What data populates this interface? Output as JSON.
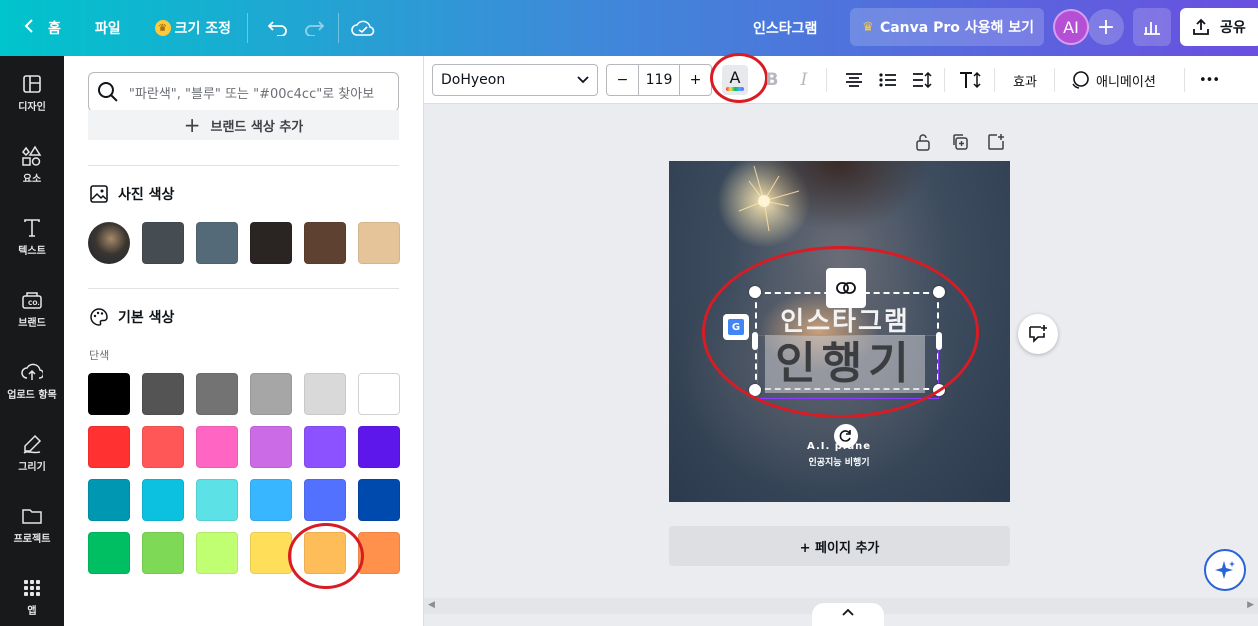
{
  "topbar": {
    "home_label": "홈",
    "file_label": "파일",
    "resize_label": "크기 조정",
    "doc_title": "인스타그램",
    "pro_label": "Canva Pro 사용해 보기",
    "avatar_initials": "AI",
    "share_label": "공유"
  },
  "rail": {
    "items": [
      {
        "label": "디자인",
        "icon": "layout-icon"
      },
      {
        "label": "요소",
        "icon": "shapes-icon"
      },
      {
        "label": "텍스트",
        "icon": "text-icon"
      },
      {
        "label": "브랜드",
        "icon": "brand-icon"
      },
      {
        "label": "업로드 항목",
        "icon": "upload-icon"
      },
      {
        "label": "그리기",
        "icon": "draw-icon"
      },
      {
        "label": "프로젝트",
        "icon": "folder-icon"
      },
      {
        "label": "앱",
        "icon": "apps-icon"
      }
    ]
  },
  "panel": {
    "search_placeholder": "\"파란색\", \"블루\" 또는 \"#00c4cc\"로 찾아보",
    "brand_add_label": "브랜드 색상 추가",
    "photo_colors_title": "사진 색상",
    "photo_colors": [
      "#454d52",
      "#546a78",
      "#2a2522",
      "#5f4131",
      "#e5c49a"
    ],
    "default_colors_title": "기본 색상",
    "solid_label": "단색",
    "solid_colors": [
      [
        "#000000",
        "#545454",
        "#737373",
        "#a6a6a6",
        "#d9d9d9",
        "#ffffff"
      ],
      [
        "#ff3131",
        "#ff5757",
        "#ff66c4",
        "#cb6ce6",
        "#8c52ff",
        "#5e17eb"
      ],
      [
        "#0097b2",
        "#0cc0df",
        "#5ce1e6",
        "#38b6ff",
        "#5271ff",
        "#004aad"
      ],
      [
        "#00bf63",
        "#7ed957",
        "#c1ff72",
        "#ffde59",
        "#ffbd59",
        "#ff914d"
      ]
    ]
  },
  "format": {
    "font_name": "DoHyeon",
    "font_size": "119",
    "minus": "−",
    "plus": "+",
    "text_color_glyph": "A",
    "bold_glyph": "B",
    "italic_glyph": "I",
    "effects_label": "효과",
    "animate_label": "애니메이션",
    "more_glyph": "•••"
  },
  "design": {
    "headline": "인스타그램",
    "main_text": "인행기",
    "brand_name": "A.I. plane",
    "brand_sub": "인공지능 비행기",
    "add_page_label": "+ 페이지 추가"
  }
}
